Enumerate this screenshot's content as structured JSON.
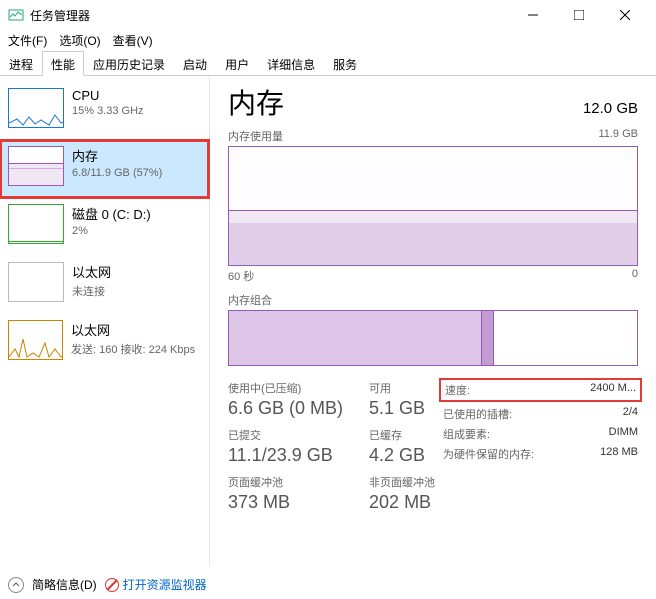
{
  "window": {
    "title": "任务管理器"
  },
  "menu": {
    "file": "文件(F)",
    "options": "选项(O)",
    "view": "查看(V)"
  },
  "tabs": [
    "进程",
    "性能",
    "应用历史记录",
    "启动",
    "用户",
    "详细信息",
    "服务"
  ],
  "active_tab": 1,
  "sidebar": [
    {
      "name": "CPU",
      "sub": "15% 3.33 GHz"
    },
    {
      "name": "内存",
      "sub": "6.8/11.9 GB (57%)"
    },
    {
      "name": "磁盘 0 (C: D:)",
      "sub": "2%"
    },
    {
      "name": "以太网",
      "sub": "未连接"
    },
    {
      "name": "以太网",
      "sub": "发送: 160 接收: 224 Kbps"
    }
  ],
  "main": {
    "title": "内存",
    "total": "12.0 GB",
    "usage_label": "内存使用量",
    "usage_max": "11.9 GB",
    "axis_left": "60 秒",
    "axis_right": "0",
    "comp_label": "内存组合",
    "stats": {
      "in_use_label": "使用中(已压缩)",
      "in_use": "6.6 GB (0 MB)",
      "avail_label": "可用",
      "avail": "5.1 GB",
      "committed_label": "已提交",
      "committed": "11.1/23.9 GB",
      "cached_label": "已缓存",
      "cached": "4.2 GB",
      "paged_label": "页面缓冲池",
      "paged": "373 MB",
      "nonpaged_label": "非页面缓冲池",
      "nonpaged": "202 MB"
    },
    "right": {
      "speed_label": "速度:",
      "speed": "2400 M...",
      "slots_label": "已使用的插槽:",
      "slots": "2/4",
      "form_label": "组成要素:",
      "form": "DIMM",
      "reserved_label": "为硬件保留的内存:",
      "reserved": "128 MB"
    }
  },
  "footer": {
    "brief": "简略信息(D)",
    "monitor": "打开资源监视器"
  }
}
